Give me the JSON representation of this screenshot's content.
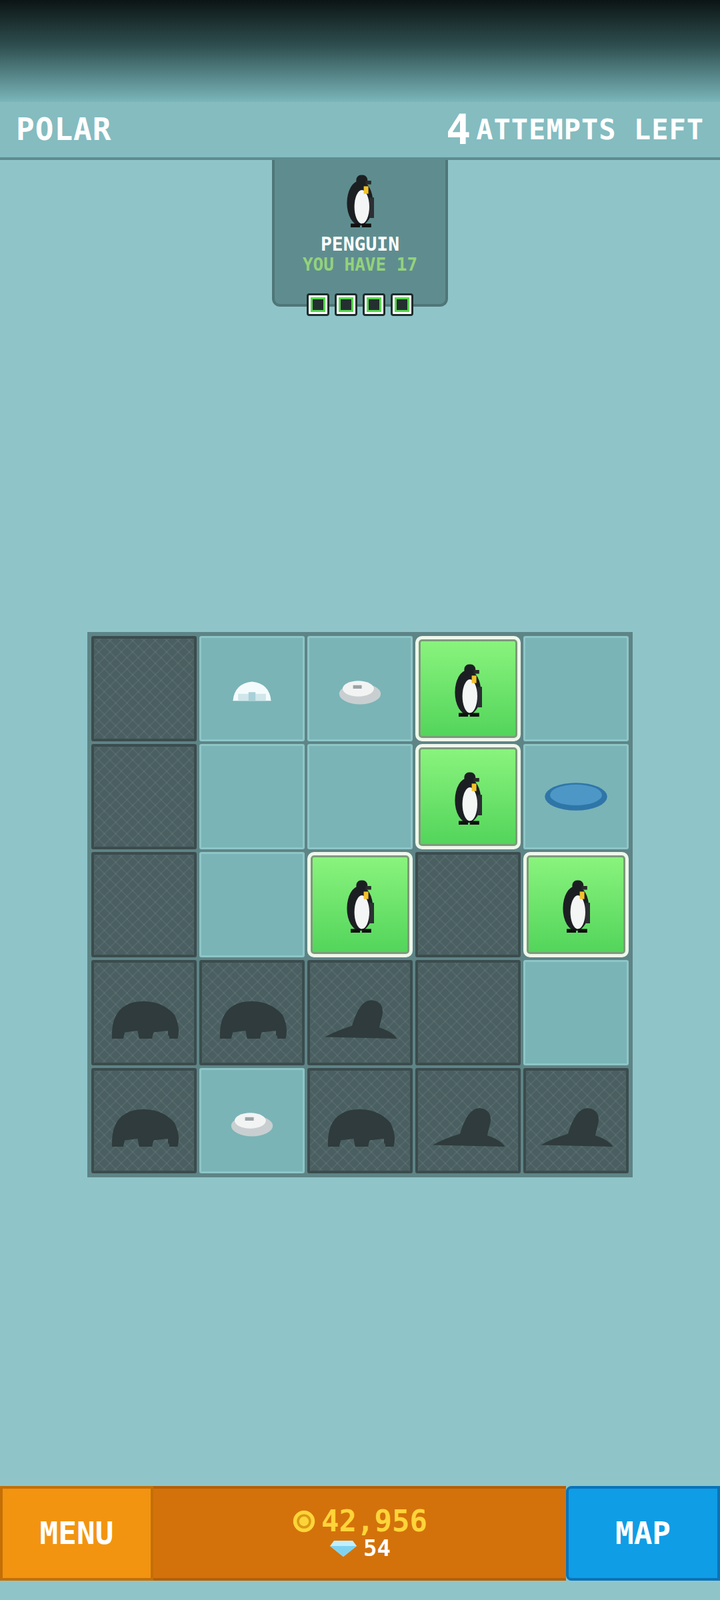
{
  "header": {
    "title": "POLAR",
    "attempts": "4",
    "attempts_label": "ATTEMPTS LEFT"
  },
  "target": {
    "name": "PENGUIN",
    "owned": "YOU HAVE 17",
    "markers": [
      {
        "filled": true
      },
      {
        "filled": true
      },
      {
        "filled": true
      },
      {
        "filled": true
      }
    ]
  },
  "board": {
    "rows": [
      [
        {
          "kind": "empty"
        },
        {
          "kind": "hidden-ice"
        },
        {
          "kind": "hidden-rock"
        },
        {
          "kind": "penguin"
        },
        {
          "kind": "hidden"
        }
      ],
      [
        {
          "kind": "empty"
        },
        {
          "kind": "hidden"
        },
        {
          "kind": "hidden"
        },
        {
          "kind": "penguin"
        },
        {
          "kind": "hidden-puddle"
        }
      ],
      [
        {
          "kind": "empty"
        },
        {
          "kind": "hidden"
        },
        {
          "kind": "penguin"
        },
        {
          "kind": "empty"
        },
        {
          "kind": "penguin"
        }
      ],
      [
        {
          "kind": "walrus"
        },
        {
          "kind": "walrus"
        },
        {
          "kind": "seal"
        },
        {
          "kind": "empty"
        },
        {
          "kind": "hidden"
        }
      ],
      [
        {
          "kind": "walrus"
        },
        {
          "kind": "hidden-rock"
        },
        {
          "kind": "walrus"
        },
        {
          "kind": "seal"
        },
        {
          "kind": "seal"
        }
      ]
    ]
  },
  "footer": {
    "menu": "MENU",
    "coins": "42,956",
    "gems": "54",
    "map": "MAP"
  }
}
